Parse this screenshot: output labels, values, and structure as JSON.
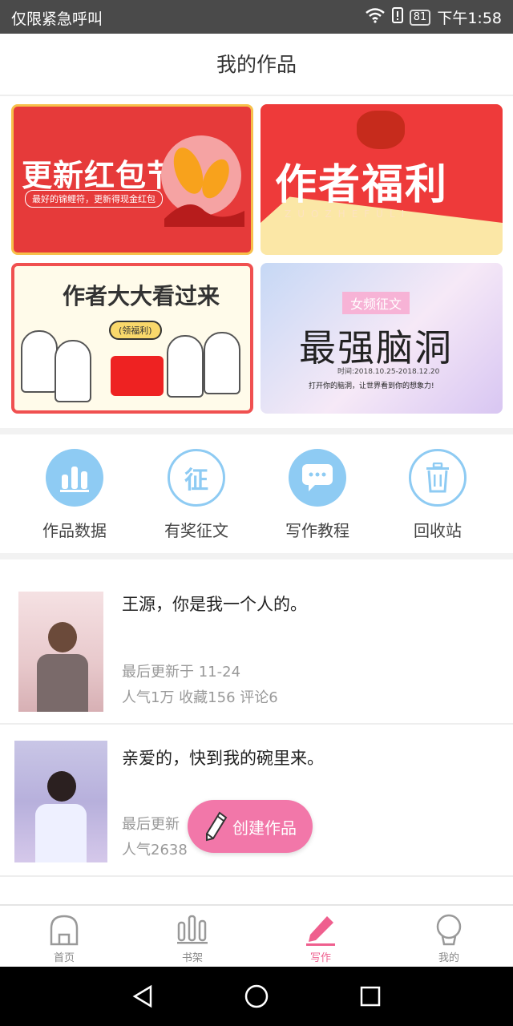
{
  "status_bar": {
    "carrier": "仅限紧急呼叫",
    "battery": "81",
    "time": "下午1:58"
  },
  "header": {
    "title": "我的作品"
  },
  "banners": {
    "red_packet": {
      "title": "更新红包节",
      "subtitle": "最好的锦鲤符，更新得现金红包"
    },
    "welfare": {
      "title": "作者福利",
      "pinyin": "ZUOZHEFULI"
    },
    "come_see": {
      "title": "作者大大看过来",
      "tag": "(领福利)"
    },
    "contest": {
      "tag": "女频征文",
      "title": "最强脑洞",
      "date": "时间:2018.10.25-2018.12.20",
      "desc": "打开你的脑洞，让世界看到你的想象力!"
    }
  },
  "actions": [
    {
      "label": "作品数据",
      "icon": "bar-chart-icon"
    },
    {
      "label": "有奖征文",
      "icon": "contest-icon",
      "glyph": "征"
    },
    {
      "label": "写作教程",
      "icon": "message-icon"
    },
    {
      "label": "回收站",
      "icon": "trash-icon"
    }
  ],
  "works": [
    {
      "title": "王源，你是我一个人的。",
      "updated": "最后更新于 11-24",
      "stats": "人气1万  收藏156  评论6"
    },
    {
      "title": "亲爱的，快到我的碗里来。",
      "updated": "最后更新",
      "stats": "人气2638"
    }
  ],
  "fab": {
    "label": "创建作品"
  },
  "tabs": [
    {
      "label": "首页",
      "icon": "home-icon"
    },
    {
      "label": "书架",
      "icon": "bookshelf-icon"
    },
    {
      "label": "写作",
      "icon": "pen-icon"
    },
    {
      "label": "我的",
      "icon": "profile-icon"
    }
  ],
  "colors": {
    "accent": "#ef5f8e",
    "icon_blue": "#8ecbf3",
    "fab": "#f277a9"
  }
}
